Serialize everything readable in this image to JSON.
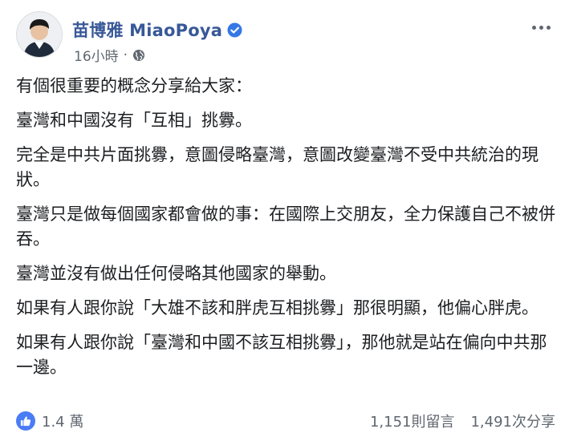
{
  "post": {
    "author": "苗博雅 MiaoPoya",
    "time": "16小時",
    "separator": "·",
    "paragraphs": [
      "有個很重要的概念分享給大家：",
      "臺灣和中國沒有「互相」挑釁。",
      "完全是中共片面挑釁，意圖侵略臺灣，意圖改變臺灣不受中共統治的現狀。",
      "臺灣只是做每個國家都會做的事：在國際上交朋友，全力保護自己不被併吞。",
      "臺灣並沒有做出任何侵略其他國家的舉動。",
      "如果有人跟你說「大雄不該和胖虎互相挑釁」那很明顯，他偏心胖虎。",
      "如果有人跟你說「臺灣和中國不該互相挑釁」，那他就是站在偏向中共那一邊。"
    ]
  },
  "footer": {
    "reaction_count": "1.4 萬",
    "comments": "1,151則留言",
    "shares": "1,491次分享"
  },
  "icons": {
    "verified": "verified-badge-icon",
    "audience": "globe-icon",
    "options": "more-options-icon",
    "like": "like-thumb-icon"
  },
  "colors": {
    "author_link": "#385898",
    "verified": "#3578e5",
    "meta_gray": "#606770",
    "like_blue": "#4a7cf6"
  }
}
